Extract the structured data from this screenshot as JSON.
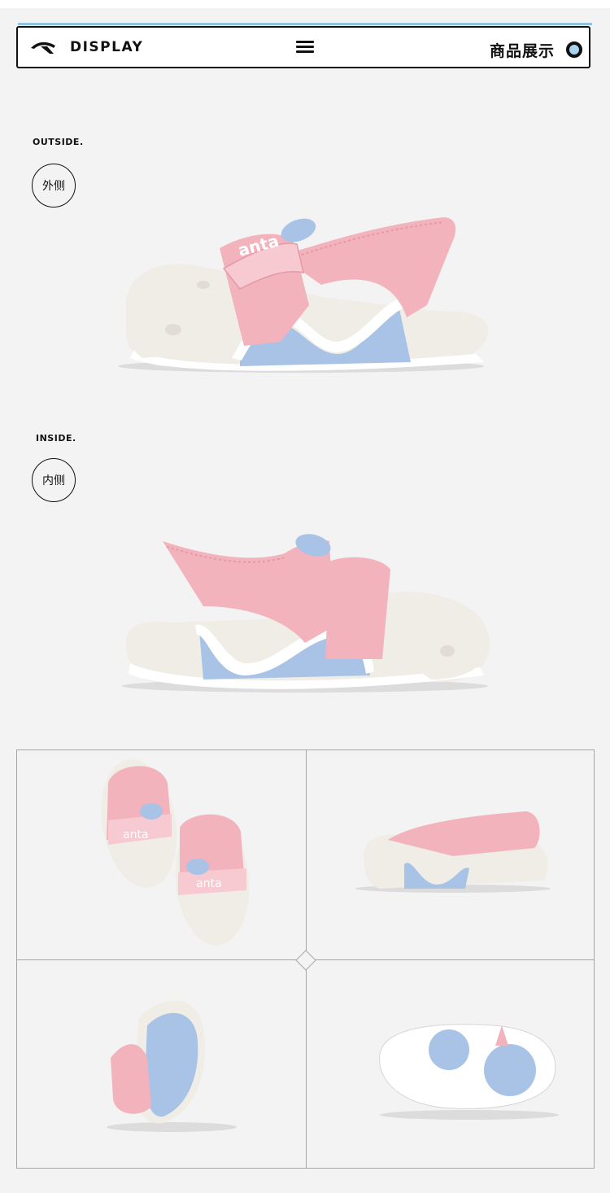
{
  "header": {
    "brand": "DISPLAY",
    "section_title": "商品展示"
  },
  "outside": {
    "label_en": "OUTSIDE.",
    "label_cn": "外侧"
  },
  "inside": {
    "label_en": "INSIDE.",
    "label_cn": "内侧"
  },
  "shoe_text": {
    "strap_logo": "anta"
  },
  "colors": {
    "background": "#f3f3f3",
    "shoe_pink": "#f2b3bd",
    "shoe_cream": "#efede6",
    "sole_blue": "#a8c3e6",
    "accent_blue": "#8ec3e6"
  }
}
